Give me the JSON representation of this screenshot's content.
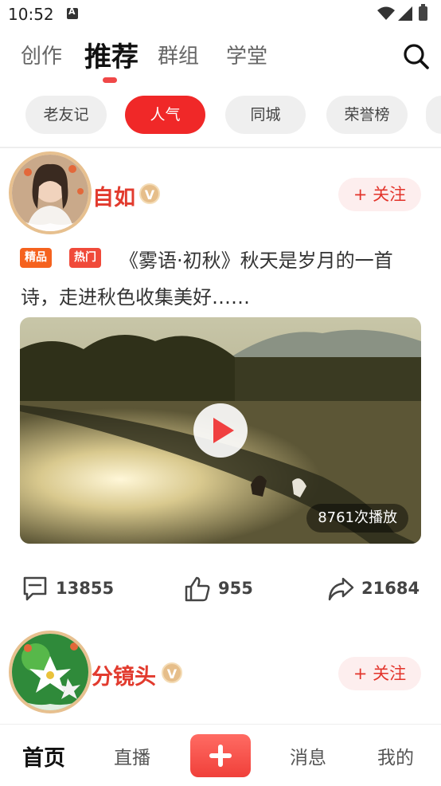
{
  "status_bar": {
    "time": "10:52"
  },
  "tabs": [
    {
      "label": "创作",
      "active": false
    },
    {
      "label": "推荐",
      "active": true
    },
    {
      "label": "群组",
      "active": false
    },
    {
      "label": "学堂",
      "active": false
    }
  ],
  "chips": [
    {
      "label": "老友记",
      "active": false
    },
    {
      "label": "人气",
      "active": true
    },
    {
      "label": "同城",
      "active": false
    },
    {
      "label": "荣誉榜",
      "active": false
    }
  ],
  "posts": [
    {
      "username": "自如",
      "verified": true,
      "follow_label": "+ 关注",
      "tags": [
        "精品",
        "热门"
      ],
      "text": "《雾语·初秋》秋天是岁月的一首诗，走进秋色收集美好……",
      "play_count": "8761次播放",
      "comments": "13855",
      "likes": "955",
      "shares": "21684"
    },
    {
      "username": "分镜头",
      "verified": true,
      "follow_label": "+ 关注"
    }
  ],
  "bottom_nav": [
    {
      "label": "首页",
      "active": true
    },
    {
      "label": "直播",
      "active": false
    },
    {
      "label": "消息",
      "active": false
    },
    {
      "label": "我的",
      "active": false
    }
  ],
  "colors": {
    "accent": "#f02828",
    "username": "#e23b2e",
    "tag_jingpin": "#f5621e",
    "tag_remen": "#f04a3a"
  },
  "icons": [
    "search-icon",
    "play-icon",
    "comment-icon",
    "like-icon",
    "share-icon",
    "plus-icon",
    "verified-icon",
    "wifi-icon",
    "signal-icon",
    "battery-icon"
  ]
}
